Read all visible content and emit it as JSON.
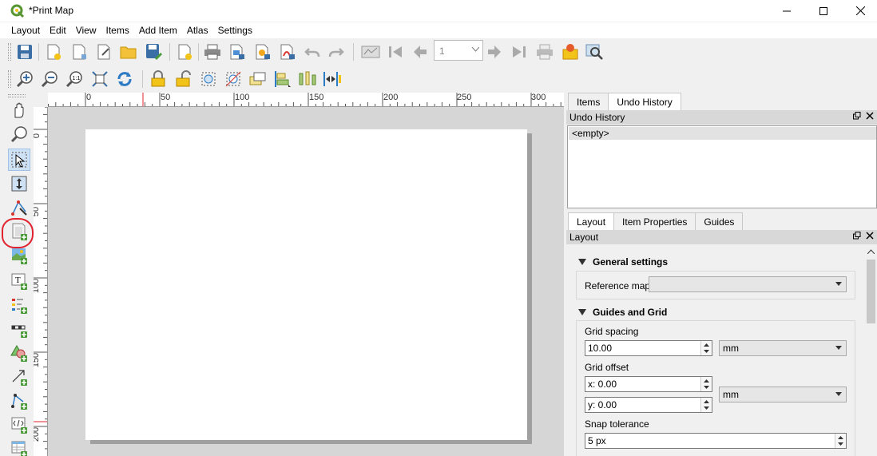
{
  "window": {
    "title": "*Print Map"
  },
  "menu": [
    "Layout",
    "Edit",
    "View",
    "Items",
    "Add Item",
    "Atlas",
    "Settings"
  ],
  "toolbar": {
    "page_number": "1"
  },
  "rulers": {
    "horizontal": [
      "0",
      "50",
      "100",
      "150",
      "200",
      "250",
      "300"
    ],
    "vertical": [
      "0",
      "50",
      "100",
      "150",
      "200"
    ]
  },
  "top_tabs": [
    {
      "label": "Items"
    },
    {
      "label": "Undo History"
    }
  ],
  "undo": {
    "header": "Undo History",
    "items": [
      "<empty>"
    ]
  },
  "bottom_tabs": [
    {
      "label": "Layout"
    },
    {
      "label": "Item Properties"
    },
    {
      "label": "Guides"
    }
  ],
  "layout_panel": {
    "header": "Layout",
    "general": {
      "title": "General settings",
      "reference_map_label": "Reference map",
      "reference_map_value": ""
    },
    "guides": {
      "title": "Guides and Grid",
      "grid_spacing_label": "Grid spacing",
      "grid_spacing_value": "10.00",
      "grid_spacing_unit": "mm",
      "grid_offset_label": "Grid offset",
      "offset_x": "x: 0.00",
      "offset_y": "y: 0.00",
      "offset_unit": "mm",
      "snap_label": "Snap tolerance",
      "snap_value": "5 px"
    }
  },
  "colors": {
    "accent": "#e0232f",
    "selected_tool": "#cfe2f5",
    "qgis_green": "#589632"
  }
}
